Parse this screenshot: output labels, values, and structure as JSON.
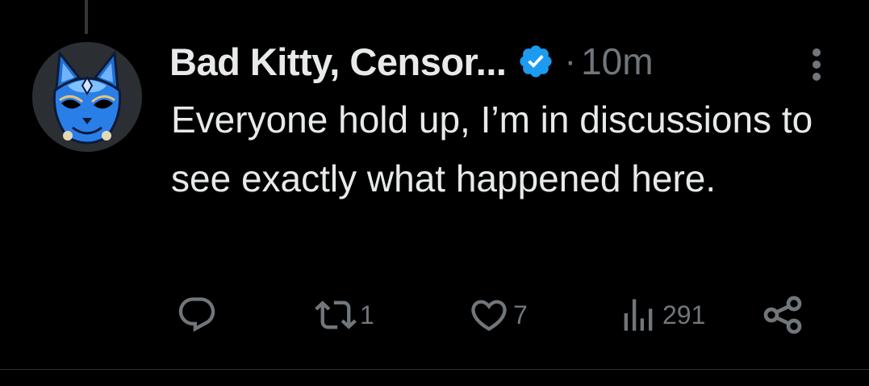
{
  "tweet": {
    "display_name": "Bad Kitty, Censor...",
    "verified": true,
    "separator": "·",
    "timestamp": "10m",
    "text": "Everyone hold up, I’m in discussions to see exactly what happened here."
  },
  "actions": {
    "reply_count": "",
    "repost_count": "1",
    "like_count": "7",
    "views_count": "291"
  },
  "icons": {
    "avatar": "blue-cat-mask-avatar",
    "verified": "verified-badge-icon",
    "more": "more-options-icon",
    "reply": "reply-icon",
    "repost": "repost-icon",
    "like": "heart-icon",
    "views": "views-icon",
    "share": "share-icon"
  },
  "colors": {
    "background": "#000000",
    "primary_text": "#e7e9ea",
    "secondary_text": "#71767b",
    "verified_blue": "#1d9bf0",
    "thread_line": "#333639"
  }
}
